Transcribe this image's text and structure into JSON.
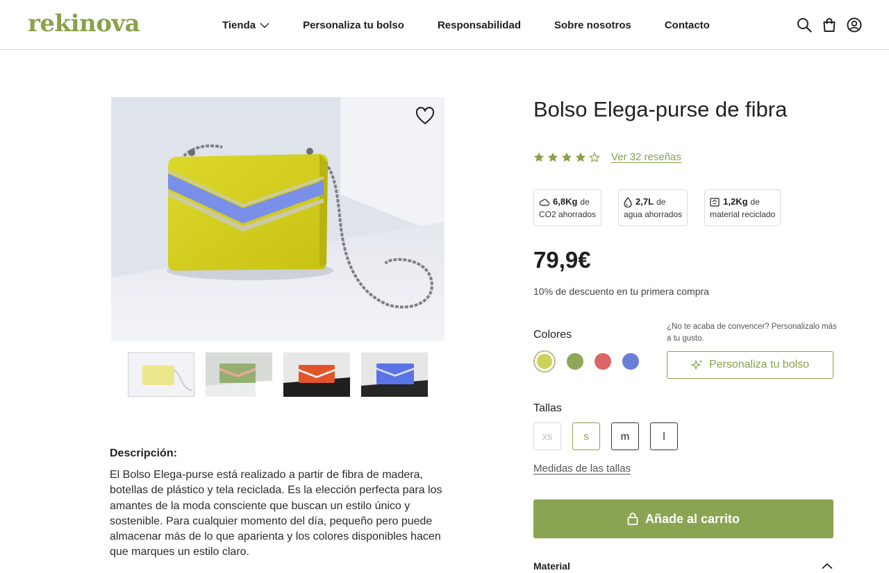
{
  "brand": {
    "logo_text": "rekinova",
    "accent": "#8aa14c"
  },
  "nav": {
    "items": [
      {
        "label": "Tienda",
        "has_dropdown": true
      },
      {
        "label": "Personaliza tu bolso"
      },
      {
        "label": "Responsabilidad"
      },
      {
        "label": "Sobre nosotros"
      },
      {
        "label": "Contacto"
      }
    ],
    "icons": [
      "search-icon",
      "shopping-bag-icon",
      "user-account-icon"
    ]
  },
  "gallery": {
    "thumbnails": [
      {
        "color": "#e7e27a",
        "name": "yellow"
      },
      {
        "color": "#93b071",
        "name": "green"
      },
      {
        "color": "#e2552b",
        "name": "red"
      },
      {
        "color": "#5a73e6",
        "name": "blue"
      }
    ]
  },
  "product": {
    "title": "Bolso Elega-purse de fibra",
    "rating": 4,
    "rating_max": 5,
    "reviews_label": "Ver 32 reseñas",
    "impact": [
      {
        "icon": "cloud-icon",
        "value": "6,8Kg",
        "suffix": "de",
        "caption": "CO2 ahorrados"
      },
      {
        "icon": "water-drop-icon",
        "value": "2,7L",
        "suffix": "de",
        "caption": "agua ahorrados"
      },
      {
        "icon": "recycle-box-icon",
        "value": "1,2Kg",
        "suffix": "de",
        "caption": "material reciclado"
      }
    ],
    "price": "79,9€",
    "discount_note": "10% de descuento en tu primera compra",
    "colors_label": "Colores",
    "colors": [
      {
        "name": "yellow",
        "hex": "#cfd25a",
        "selected": true
      },
      {
        "name": "green",
        "hex": "#8ea858",
        "selected": false
      },
      {
        "name": "red",
        "hex": "#de6565",
        "selected": false
      },
      {
        "name": "blue",
        "hex": "#6a7fd8",
        "selected": false
      }
    ],
    "personalize_note": "¿No te acaba de convencer? Personalizalo más a tu gusto.",
    "personalize_button": "Personaliza tu bolso",
    "sizes_label": "Tallas",
    "sizes": [
      {
        "label": "xs",
        "state": "disabled"
      },
      {
        "label": "s",
        "state": "selected"
      },
      {
        "label": "m",
        "state": "available"
      },
      {
        "label": "l",
        "state": "available"
      }
    ],
    "size_guide_label": "Medidas de las tallas",
    "add_to_cart": "Añade al carrito",
    "material_label": "Material"
  },
  "description": {
    "title": "Descripción:",
    "text": "El Bolso Elega-purse está realizado a partir de fibra de madera, botellas de plástico y tela reciclada. Es la elección perfecta para los amantes de la moda consciente que buscan un estilo único y sostenible. Para cualquier momento del día, pequeño pero puede almacenar más de lo que aparienta y los colores disponibles hacen que marques un estilo claro."
  }
}
